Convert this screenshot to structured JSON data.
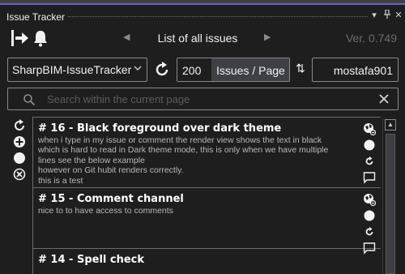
{
  "window": {
    "title": "Issue Tracker",
    "controls": {
      "dropdown": "▾",
      "pin": "ᛘ",
      "close": "✕"
    }
  },
  "nav": {
    "title": "List of all issues",
    "version": "Ver. 0.749",
    "prev_glyph": "◀",
    "next_glyph": "▶"
  },
  "toolbar": {
    "repository": "SharpBIM-IssueTracker",
    "page_size": "200",
    "page_size_label": "Issues / Page",
    "username": "mostafa901",
    "sort_glyph": "⇅"
  },
  "search": {
    "placeholder": "Search within the current page"
  },
  "side_tools": [
    "refresh-icon",
    "add-icon",
    "circle-icon",
    "remove-icon"
  ],
  "issues": [
    {
      "title": "# 16 - Black foreground over dark theme",
      "body": [
        "when i type  in my issue or comment the render view shows the text in black",
        "which is hard to read in Dark theme mode,  this is only when we have multiple",
        "lines see the below example",
        "however on Git hubit renders correctly.",
        "this is a test"
      ]
    },
    {
      "title": "# 15 - Comment channel",
      "body": [
        "nice to to have access to comments",
        "",
        "",
        ""
      ]
    },
    {
      "title": "# 14 - Spell check",
      "body": []
    }
  ],
  "colors": {
    "background": "#1e1e1e",
    "accent": "#6a5fc1",
    "border": "#8a8a8a",
    "muted": "#6b6b6b"
  }
}
